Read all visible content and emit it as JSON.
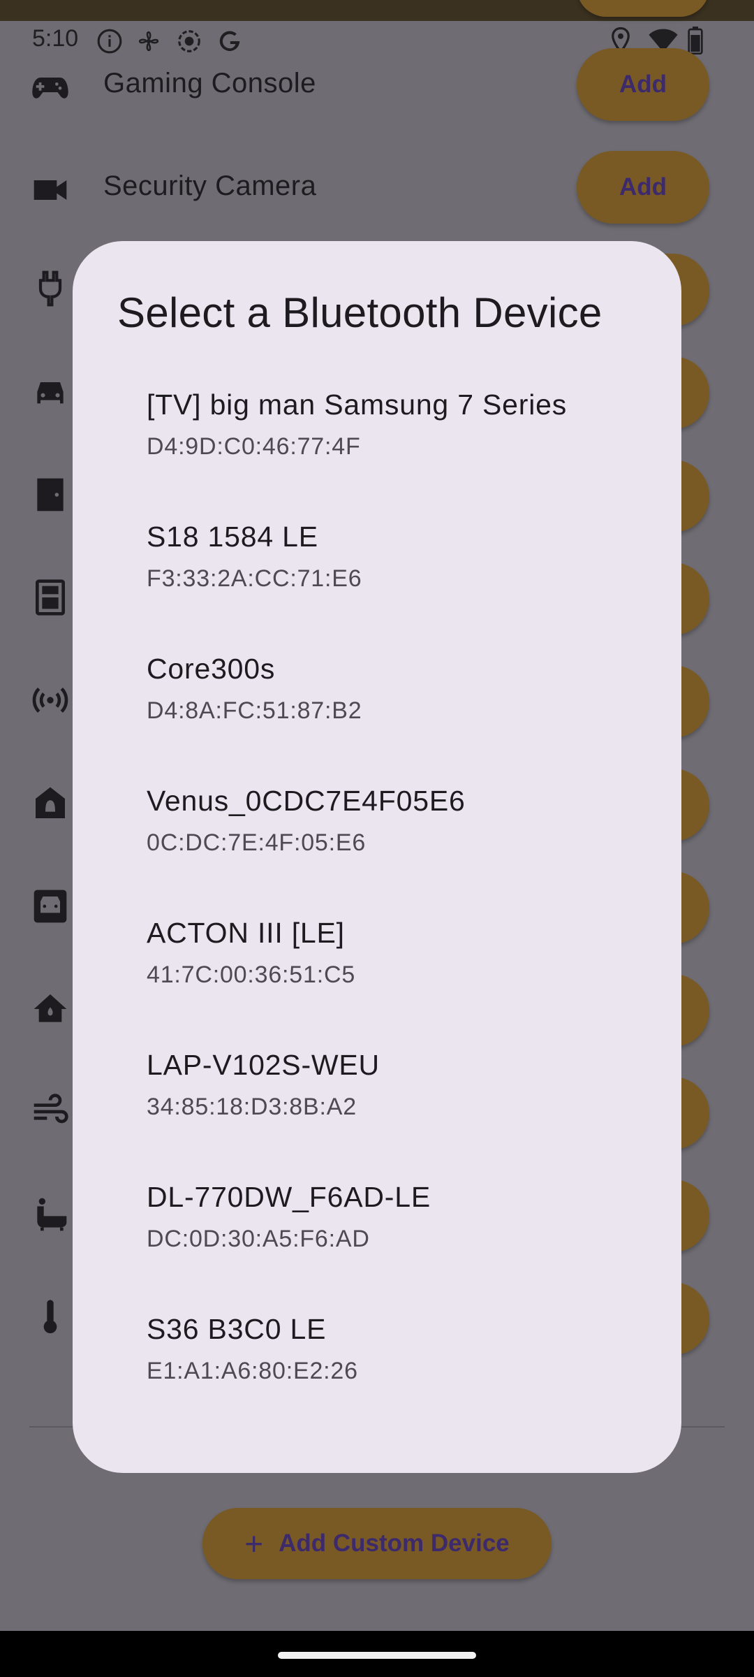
{
  "status_bar": {
    "time": "5:10",
    "left_icons": [
      "info-icon",
      "fan-icon",
      "focus-icon",
      "google-icon"
    ],
    "right_icons": [
      "location-icon",
      "wifi-icon",
      "battery-icon"
    ]
  },
  "background": {
    "device_rows": [
      {
        "label": "Gaming Console",
        "icon": "gamepad-icon",
        "button": "Add"
      },
      {
        "label": "Security Camera",
        "icon": "camera-icon",
        "button": "Add"
      }
    ],
    "partial_icons": [
      "plug-icon",
      "car-icon",
      "door-icon",
      "appliance-icon",
      "signal-icon",
      "bell-icon",
      "vehicle-icon",
      "home-icon",
      "wind-icon",
      "bath-icon",
      "thermometer-icon"
    ],
    "custom_device_button": "Add Custom Device"
  },
  "dialog": {
    "title": "Select a Bluetooth Device",
    "devices": [
      {
        "name": "[TV] big man Samsung 7 Series",
        "mac": "D4:9D:C0:46:77:4F"
      },
      {
        "name": "S18 1584 LE",
        "mac": "F3:33:2A:CC:71:E6"
      },
      {
        "name": "Core300s",
        "mac": "D4:8A:FC:51:87:B2"
      },
      {
        "name": "Venus_0CDC7E4F05E6",
        "mac": "0C:DC:7E:4F:05:E6"
      },
      {
        "name": "ACTON III [LE]",
        "mac": "41:7C:00:36:51:C5"
      },
      {
        "name": "LAP-V102S-WEU",
        "mac": "34:85:18:D3:8B:A2"
      },
      {
        "name": "DL-770DW_F6AD-LE",
        "mac": "DC:0D:30:A5:F6:AD"
      },
      {
        "name": "S36 B3C0 LE",
        "mac": "E1:A1:A6:80:E2:26"
      }
    ]
  },
  "colors": {
    "scrim": "#6f6d73",
    "dialog_bg": "#ebe5f0",
    "button_bg": "#7a5a24",
    "button_text": "#3c2a6b"
  }
}
